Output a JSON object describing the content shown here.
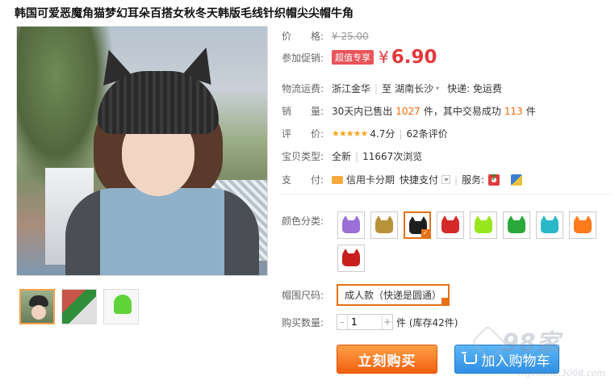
{
  "product": {
    "title": "韩国可爱恶魔角猫梦幻耳朵百搭女秋冬天韩版毛线针织帽尖尖帽牛角"
  },
  "price": {
    "label": "价　　格:",
    "original": "¥ 25.00",
    "promo_label": "参加促销:",
    "promo_badge": "超值专享",
    "currency": "¥",
    "promo_price": "6.90"
  },
  "shipping": {
    "label": "物流运费:",
    "from": "浙江金华",
    "separator": "|",
    "to_prefix": "至",
    "to": "湖南长沙",
    "express": "快递: 免运费"
  },
  "sales": {
    "label": "销　　量:",
    "prefix": "30天内已售出",
    "sold": "1027",
    "middle": "件，其中交易成功",
    "success": "113",
    "suffix": "件"
  },
  "rating": {
    "label": "评　　价:",
    "stars": "★★★★★",
    "score": "4.7分",
    "separator": "|",
    "count": "62条评价"
  },
  "item_type": {
    "label": "宝贝类型:",
    "value": "全新",
    "separator": "|",
    "views": "11667次浏览"
  },
  "payment": {
    "label": "支　　付:",
    "credit": "信用卡分期",
    "quick": "快捷支付",
    "service_label": "服务:"
  },
  "colors": {
    "label": "颜色分类:",
    "items": [
      {
        "name": "purple",
        "hex": "#9b6fd6",
        "selected": false
      },
      {
        "name": "khaki",
        "hex": "#b8923a",
        "selected": false
      },
      {
        "name": "black",
        "hex": "#1e1e1e",
        "selected": true
      },
      {
        "name": "red",
        "hex": "#d42a2a",
        "selected": false
      },
      {
        "name": "lime",
        "hex": "#9ae61e",
        "selected": false
      },
      {
        "name": "green",
        "hex": "#2aa83a",
        "selected": false
      },
      {
        "name": "cyan",
        "hex": "#2ab8c8",
        "selected": false
      },
      {
        "name": "orange",
        "hex": "#ff7a1a",
        "selected": false
      },
      {
        "name": "crimson",
        "hex": "#c81e1e",
        "selected": false
      }
    ]
  },
  "size": {
    "label": "帽围尺码:",
    "value": "成人款（快递是圆通）"
  },
  "quantity": {
    "label": "购买数量:",
    "minus": "-",
    "value": "1",
    "plus": "+",
    "stock": "件 (库存42件)"
  },
  "actions": {
    "buy_now": "立刻购买",
    "add_to_cart": "加入购物车"
  },
  "watermark": {
    "text": "98家",
    "url": "myHome.3008.com"
  }
}
